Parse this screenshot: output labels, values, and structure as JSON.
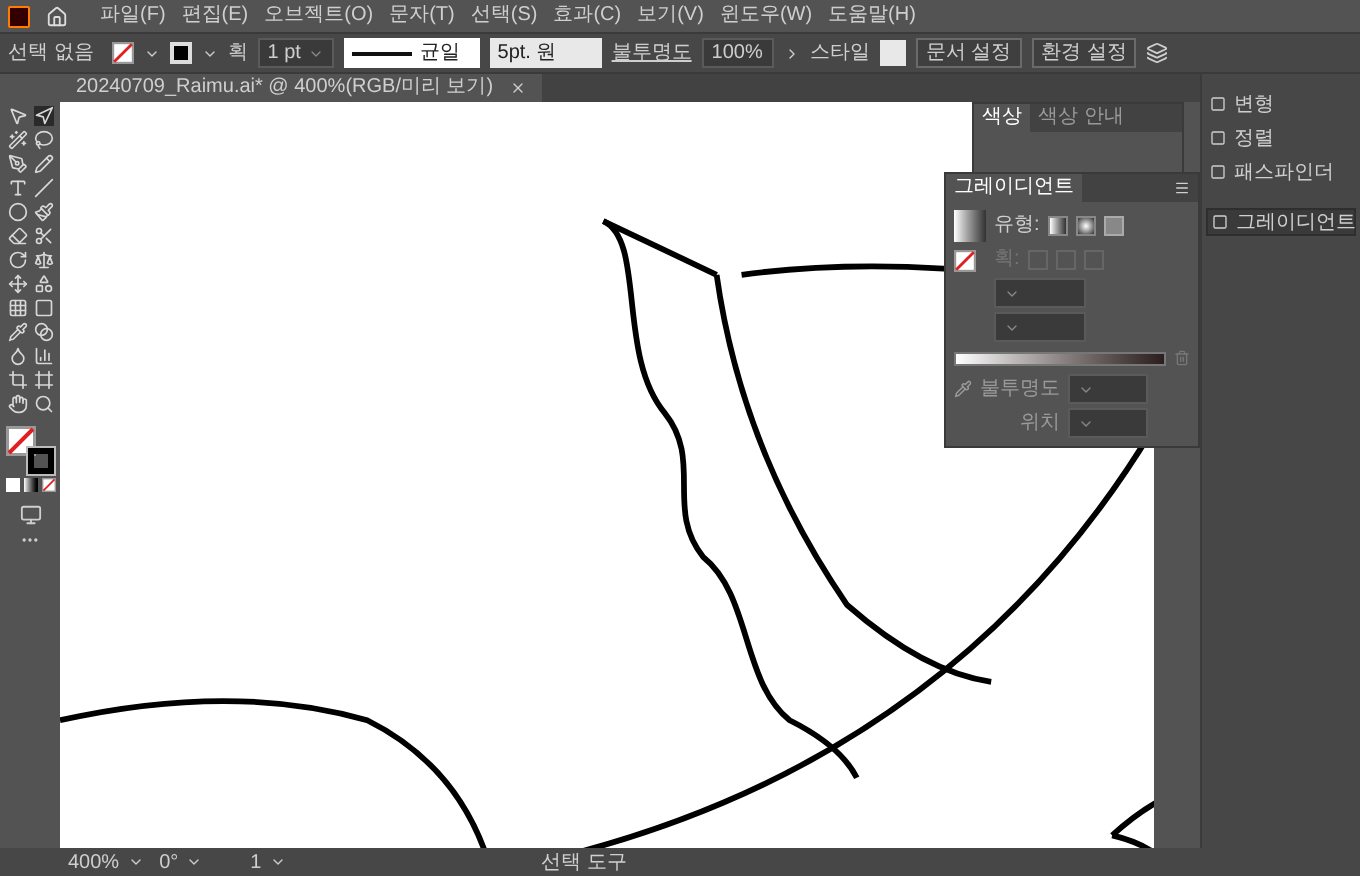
{
  "menu": [
    "파일(F)",
    "편집(E)",
    "오브젝트(O)",
    "문자(T)",
    "선택(S)",
    "효과(C)",
    "보기(V)",
    "윈도우(W)",
    "도움말(H)"
  ],
  "control_bar": {
    "selection": "선택 없음",
    "stroke_label": "획",
    "stroke_weight": "1 pt",
    "stroke_profile": "균일",
    "brush": "5pt. 원",
    "opacity_label": "불투명도",
    "opacity": "100%",
    "style_label": "스타일",
    "buttons": [
      "문서 설정",
      "환경 설정"
    ]
  },
  "document_tab": {
    "title": "20240709_Raimu.ai* @ 400%(RGB/미리 보기)"
  },
  "color_panel": {
    "tabs": [
      {
        "label": "색상",
        "selected": true
      },
      {
        "label": "색상 안내",
        "selected": false
      }
    ]
  },
  "gradient_panel": {
    "title": "그레이디언트",
    "type_label": "유형:",
    "stroke_label": "획:",
    "opacity_label": "불투명도",
    "location_label": "위치"
  },
  "dock": [
    {
      "label": "변형",
      "selected": false
    },
    {
      "label": "정렬",
      "selected": false
    },
    {
      "label": "패스파인더",
      "selected": false
    },
    {
      "label": "그레이디언트",
      "selected": true
    }
  ],
  "status_bar": {
    "zoom": "400%",
    "rotation": "0°",
    "artboard": "1",
    "tool": "선택 도구"
  }
}
